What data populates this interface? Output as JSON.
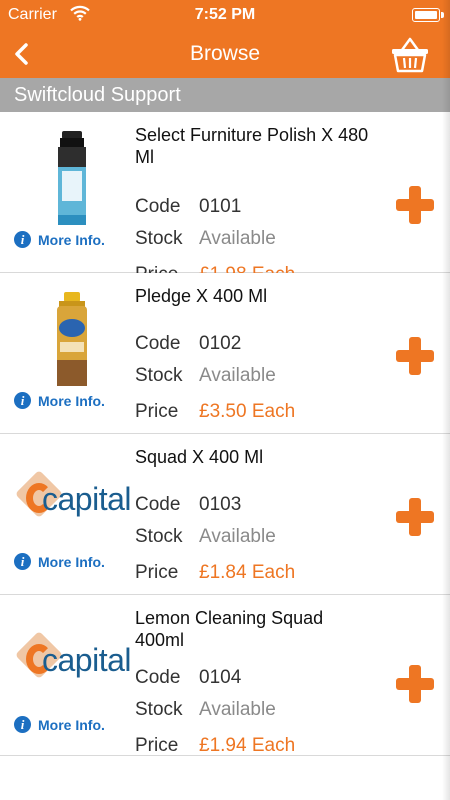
{
  "status_bar": {
    "carrier": "Carrier",
    "time": "7:52 PM"
  },
  "nav": {
    "title": "Browse",
    "back_icon": "chevron-left-icon",
    "basket_icon": "basket-icon"
  },
  "section": {
    "title": "Swiftcloud Support"
  },
  "labels": {
    "code": "Code",
    "stock": "Stock",
    "price": "Price",
    "more_info": "More Info."
  },
  "colors": {
    "accent": "#ee7623",
    "header_gray": "#a7a7a7",
    "link_blue": "#1c6fc1"
  },
  "products": [
    {
      "name": "Select Furniture Polish X 480 Ml",
      "code": "0101",
      "stock": "Available",
      "price": "£1.98 Each",
      "image": "spray-can"
    },
    {
      "name": "Pledge X 400 Ml",
      "code": "0102",
      "stock": "Available",
      "price": "£3.50 Each",
      "image": "pledge-can"
    },
    {
      "name": "Squad X 400 Ml",
      "code": "0103",
      "stock": "Available",
      "price": "£1.84 Each",
      "image": "capital-logo",
      "logo_text": "capital"
    },
    {
      "name": "Lemon Cleaning Squad 400ml",
      "code": "0104",
      "stock": "Available",
      "price": "£1.94 Each",
      "image": "capital-logo",
      "logo_text": "capital"
    }
  ]
}
